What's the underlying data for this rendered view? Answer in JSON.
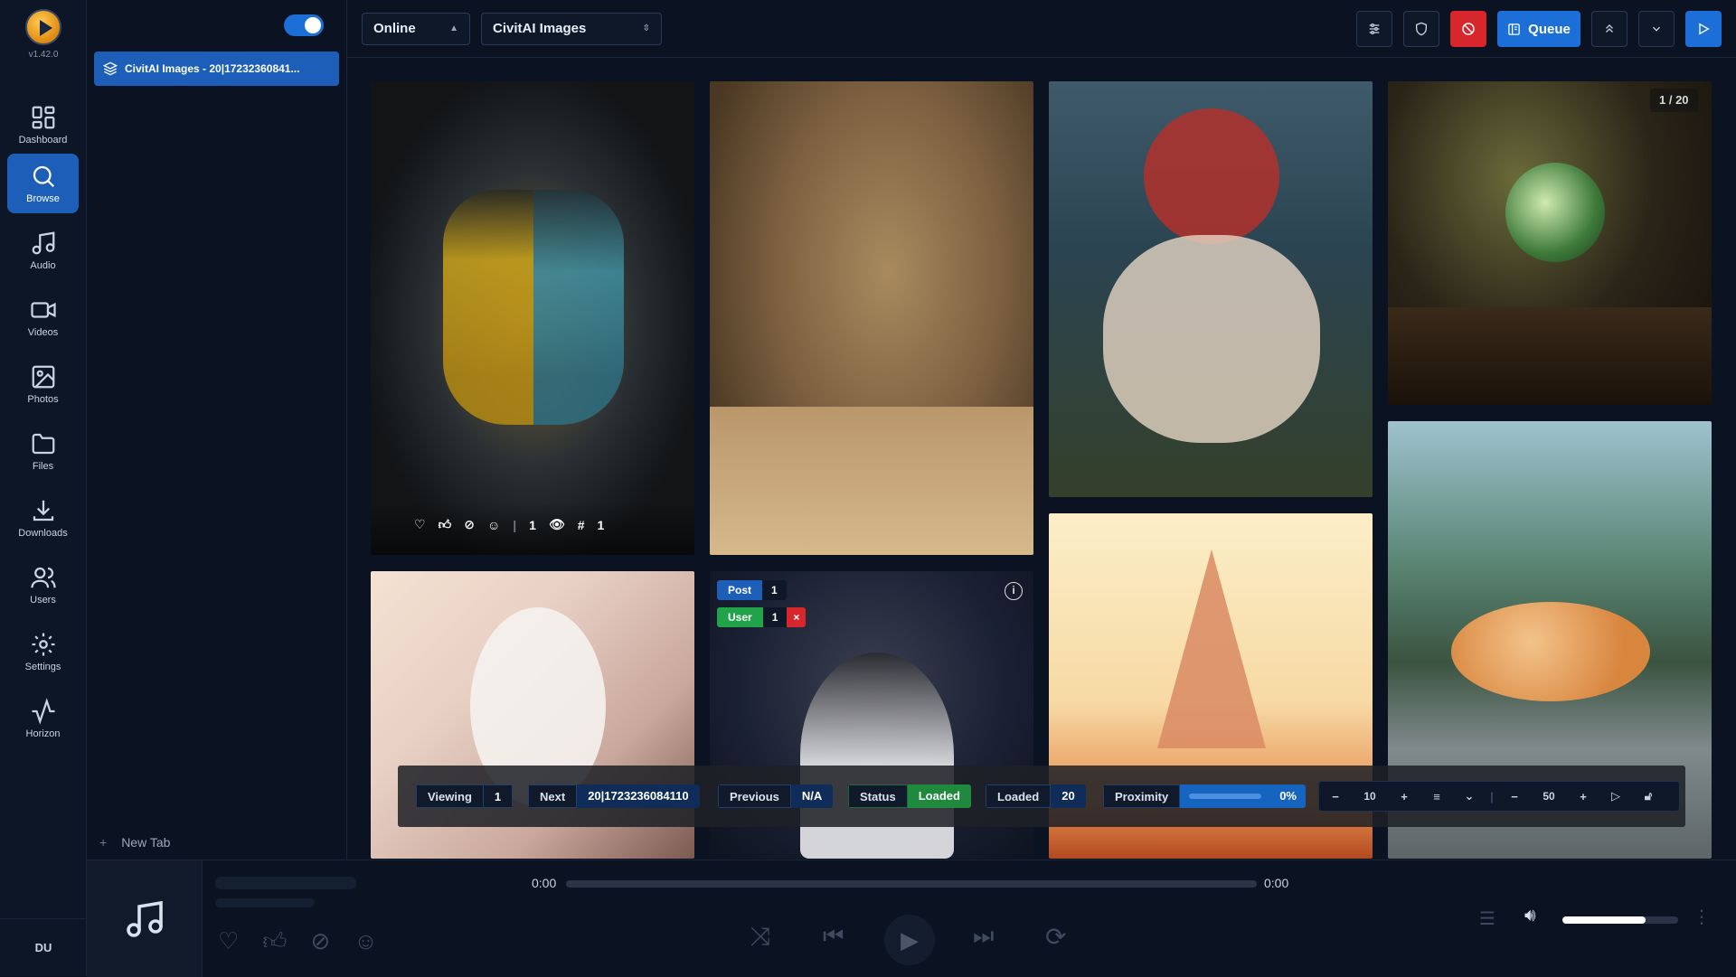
{
  "app": {
    "version": "v1.42.0",
    "user_initials": "DU"
  },
  "nav": [
    {
      "label": "Dashboard",
      "icon": "dashboard-icon"
    },
    {
      "label": "Browse",
      "icon": "search-icon",
      "active": true
    },
    {
      "label": "Audio",
      "icon": "music-note-icon"
    },
    {
      "label": "Videos",
      "icon": "video-icon"
    },
    {
      "label": "Photos",
      "icon": "photo-icon"
    },
    {
      "label": "Files",
      "icon": "folder-icon"
    },
    {
      "label": "Downloads",
      "icon": "download-icon"
    },
    {
      "label": "Users",
      "icon": "users-icon"
    },
    {
      "label": "Settings",
      "icon": "gear-icon"
    },
    {
      "label": "Horizon",
      "icon": "activity-icon"
    }
  ],
  "tabs": {
    "items": [
      {
        "label": "CivitAI Images - 20|17232360841..."
      }
    ],
    "new_tab": "New Tab",
    "toggle_on": true
  },
  "topbar": {
    "mode": "Online",
    "source": "CivitAI Images",
    "queue_label": "Queue"
  },
  "grid": {
    "counter": "1 / 20",
    "first_card": {
      "views": "1",
      "hash_count": "1"
    },
    "tags": {
      "post_label": "Post",
      "post_count": "1",
      "user_label": "User",
      "user_count": "1",
      "user_remove": "×"
    }
  },
  "status_bar": {
    "viewing_label": "Viewing",
    "viewing_value": "1",
    "next_label": "Next",
    "next_value": "20|1723236084110",
    "previous_label": "Previous",
    "previous_value": "N/A",
    "status_label": "Status",
    "status_value": "Loaded",
    "loaded_label": "Loaded",
    "loaded_value": "20",
    "proximity_label": "Proximity",
    "proximity_value": "0%",
    "proximity_fraction": 0,
    "columns_value": "10",
    "size_value": "50"
  },
  "player": {
    "elapsed": "0:00",
    "duration": "0:00",
    "progress": 0,
    "volume": 0.72
  },
  "colors": {
    "accent": "#1d6fd8",
    "danger": "#d8262d",
    "success": "#21a34a",
    "background": "#0b1322"
  }
}
